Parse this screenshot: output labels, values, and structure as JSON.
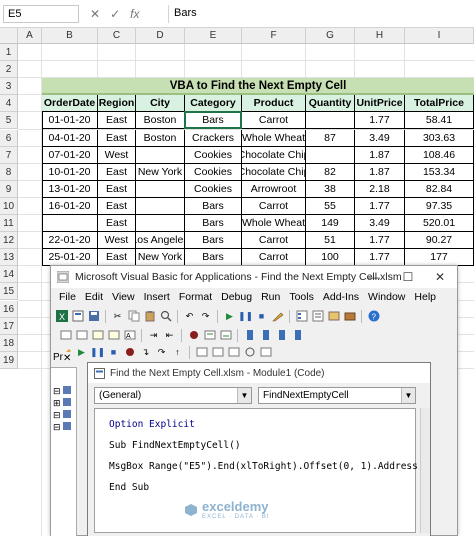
{
  "formula_bar": {
    "namebox": "E5",
    "cancel_glyph": "✕",
    "enter_glyph": "✓",
    "fx_glyph": "fx",
    "value": "Bars"
  },
  "columns": [
    "A",
    "B",
    "C",
    "D",
    "E",
    "F",
    "G",
    "H",
    "I"
  ],
  "rows": [
    "1",
    "2",
    "3",
    "4",
    "5",
    "6",
    "7",
    "8",
    "9",
    "10",
    "11",
    "12",
    "13",
    "14",
    "15",
    "16",
    "17",
    "18",
    "19"
  ],
  "title": "VBA to Find the Next Empty Cell",
  "table": {
    "headers": [
      "OrderDate",
      "Region",
      "City",
      "Category",
      "Product",
      "Quantity",
      "UnitPrice",
      "TotalPrice"
    ],
    "rows": [
      [
        "01-01-20",
        "East",
        "Boston",
        "Bars",
        "Carrot",
        "",
        "1.77",
        "58.41"
      ],
      [
        "04-01-20",
        "East",
        "Boston",
        "Crackers",
        "Whole Wheat",
        "87",
        "3.49",
        "303.63"
      ],
      [
        "07-01-20",
        "West",
        "",
        "Cookies",
        "Chocolate Chip",
        "",
        "1.87",
        "108.46"
      ],
      [
        "10-01-20",
        "East",
        "New York",
        "Cookies",
        "Chocolate Chip",
        "82",
        "1.87",
        "153.34"
      ],
      [
        "13-01-20",
        "East",
        "",
        "Cookies",
        "Arrowroot",
        "38",
        "2.18",
        "82.84"
      ],
      [
        "16-01-20",
        "East",
        "",
        "Bars",
        "Carrot",
        "55",
        "1.77",
        "97.35"
      ],
      [
        "",
        "East",
        "",
        "Bars",
        "Whole Wheat",
        "149",
        "3.49",
        "520.01"
      ],
      [
        "22-01-20",
        "West",
        "Los Angeles",
        "Bars",
        "Carrot",
        "51",
        "1.77",
        "90.27"
      ],
      [
        "25-01-20",
        "East",
        "New York",
        "Bars",
        "Carrot",
        "100",
        "1.77",
        "177"
      ]
    ]
  },
  "vba": {
    "title": "Microsoft Visual Basic for Applications - Find the Next Empty Cell.xlsm",
    "minimize": "—",
    "maximize": "☐",
    "close": "✕",
    "menu": [
      "File",
      "Edit",
      "View",
      "Insert",
      "Format",
      "Debug",
      "Run",
      "Tools",
      "Add-Ins",
      "Window",
      "Help"
    ],
    "project_tab": "Pr",
    "code_window": {
      "title": "Find the Next Empty Cell.xlsm - Module1 (Code)",
      "object_combo": "(General)",
      "proc_combo": "FindNextEmptyCell",
      "lines": [
        "Option Explicit",
        "Sub FindNextEmptyCell()",
        "MsgBox Range(\"E5\").End(xlToRight).Offset(0, 1).Address",
        "End Sub"
      ]
    }
  },
  "watermark": {
    "name": "exceldemy",
    "tagline": "EXCEL · DATA · BI"
  },
  "colors": {
    "title_fill": "#c6dfb3",
    "header_fill": "#d9f1e1",
    "keyword": "#00008b",
    "selection": "#217346"
  }
}
